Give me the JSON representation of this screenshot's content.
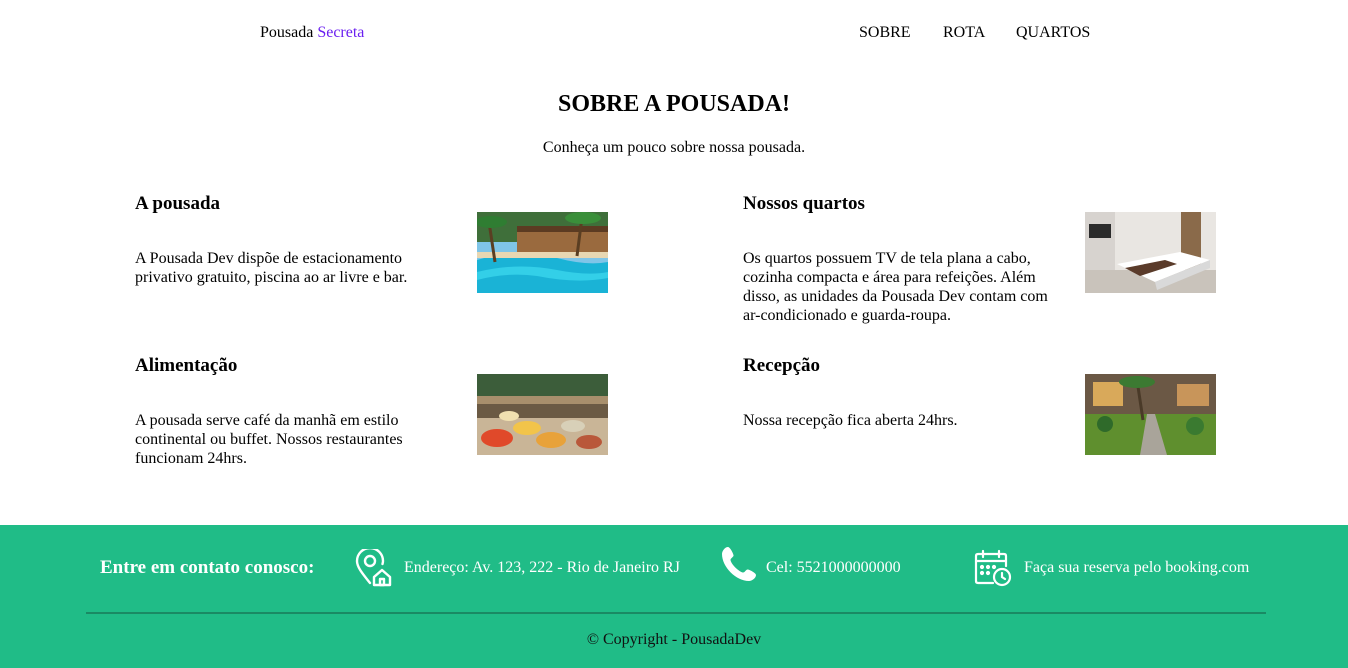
{
  "header": {
    "brand_main": "Pousada",
    "brand_accent": "Secreta",
    "nav": [
      "SOBRE",
      "ROTA",
      "QUARTOS"
    ]
  },
  "about": {
    "title": "SOBRE A POUSADA!",
    "subtitle": "Conheça um pouco sobre nossa pousada."
  },
  "cards": [
    {
      "title": "A pousada",
      "text": "A Pousada Dev dispõe de estacionamento privativo gratuito, piscina ao ar livre e bar.",
      "image": "pool-photo"
    },
    {
      "title": "Nossos quartos",
      "text": "Os quartos possuem TV de tela plana a cabo, cozinha compacta e área para refeições. Além disso, as unidades da Pousada Dev contam com ar-condicionado e guarda-roupa.",
      "image": "bedroom-photo"
    },
    {
      "title": "Alimentação",
      "text": "A pousada serve café da manhã em estilo continental ou buffet. Nossos restaurantes funcionam 24hrs.",
      "image": "buffet-photo"
    },
    {
      "title": "Recepção",
      "text": "Nossa recepção fica aberta 24hrs.",
      "image": "garden-photo"
    }
  ],
  "footer": {
    "heading": "Entre em contato conosco:",
    "address": "Endereço: Av. 123, 222 - Rio de Janeiro RJ",
    "phone": "Cel: 5521000000000",
    "booking": "Faça sua reserva pelo booking.com",
    "copyright": "© Copyright - PousadaDev",
    "icons": [
      "location-home-icon",
      "phone-icon",
      "calendar-clock-icon"
    ],
    "background_color": "#20bc87"
  },
  "colors": {
    "brand_accent": "#6a1ff0",
    "footer": "#20bc87"
  }
}
